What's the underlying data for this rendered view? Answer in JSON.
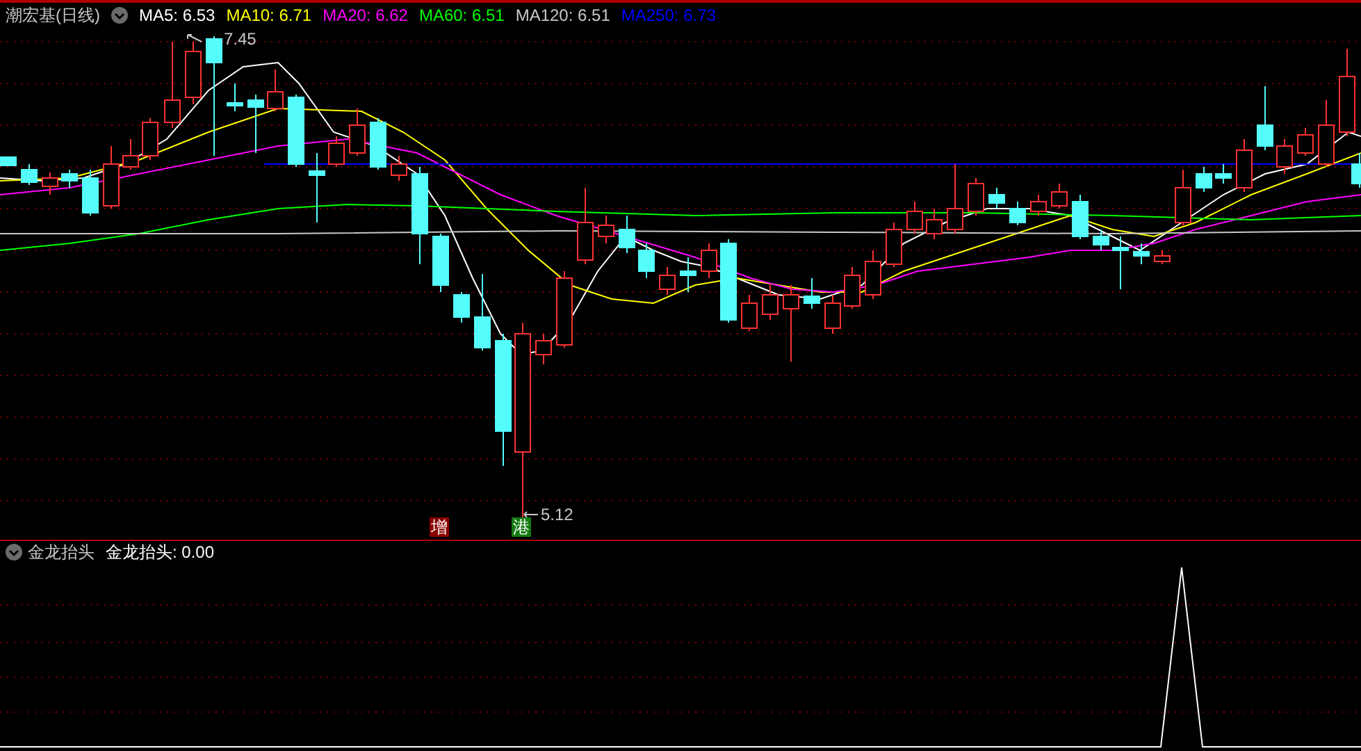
{
  "title": "潮宏基(日线)",
  "indicators": [
    {
      "label": "MA5: 6.53",
      "color": "#ffffff"
    },
    {
      "label": "MA10: 6.71",
      "color": "#ffff00"
    },
    {
      "label": "MA20: 6.62",
      "color": "#ff00ff"
    },
    {
      "label": "MA60: 6.51",
      "color": "#00ff00"
    },
    {
      "label": "MA120: 6.51",
      "color": "#c8c8c8"
    },
    {
      "label": "MA250: 6.73",
      "color": "#0000ff"
    }
  ],
  "price_chart": {
    "high_label": "7.45",
    "low_label": "5.12",
    "markers": [
      {
        "text": "增",
        "color": "#8b0000"
      },
      {
        "text": "港",
        "color": "#137a13"
      }
    ]
  },
  "lower_pane": {
    "title": "金龙抬头",
    "reading": "金龙抬头: 0.00"
  }
}
